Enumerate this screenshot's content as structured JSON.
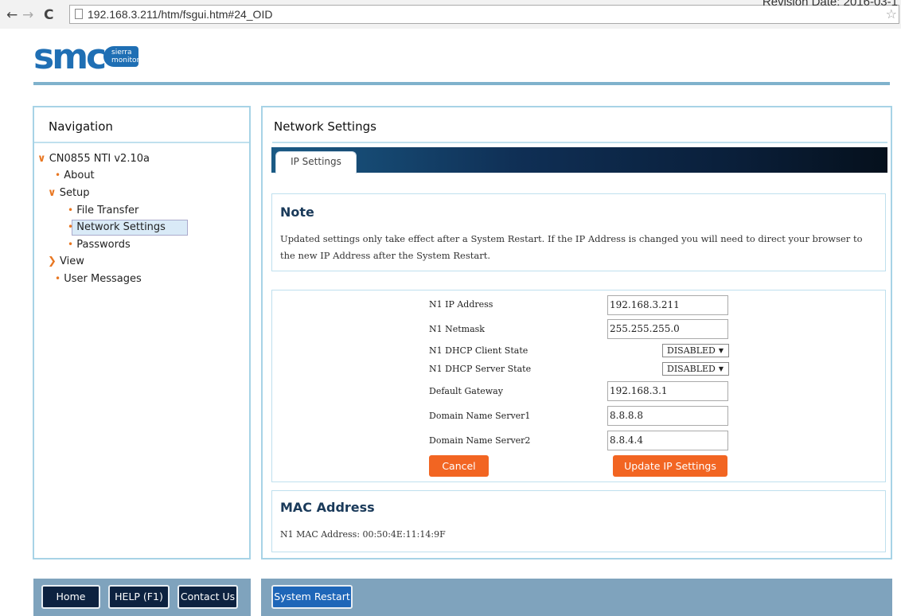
{
  "browser": {
    "back": "←",
    "forward": "→",
    "reload": "C",
    "url": "192.168.3.211/htm/fsgui.htm#24_OID",
    "revision": "Revision Date: 2016-03-1"
  },
  "logo": {
    "brand": "smc",
    "badge_line1": "sierra",
    "badge_line2": "monitor"
  },
  "nav": {
    "title": "Navigation",
    "items": [
      {
        "label": "CN0855 NTI v2.10a",
        "marker": "v"
      },
      {
        "label": "About",
        "marker": "•"
      },
      {
        "label": "Setup",
        "marker": "v"
      },
      {
        "label": "File Transfer",
        "marker": "•"
      },
      {
        "label": "Network Settings",
        "marker": "•"
      },
      {
        "label": "Passwords",
        "marker": "•"
      },
      {
        "label": "View",
        "marker": ">"
      },
      {
        "label": "User Messages",
        "marker": "•"
      }
    ]
  },
  "main": {
    "title": "Network Settings",
    "tab": "IP Settings",
    "note": {
      "title": "Note",
      "text": "Updated settings only take effect after a System Restart. If the IP Address is changed you will need to direct your browser to the new IP Address after the System Restart."
    },
    "fields": [
      {
        "label": "N1 IP Address",
        "value": "192.168.3.211"
      },
      {
        "label": "N1 Netmask",
        "value": "255.255.255.0"
      },
      {
        "label": "N1 DHCP Client State",
        "value": "DISABLED"
      },
      {
        "label": "N1 DHCP Server State",
        "value": "DISABLED"
      },
      {
        "label": "Default Gateway",
        "value": "192.168.3.1"
      },
      {
        "label": "Domain Name Server1",
        "value": "8.8.8.8"
      },
      {
        "label": "Domain Name Server2",
        "value": "8.8.4.4"
      }
    ],
    "cancel_label": "Cancel",
    "update_label": "Update IP Settings",
    "mac": {
      "title": "MAC Address",
      "text": "N1 MAC Address: 00:50:4E:11:14:9F"
    }
  },
  "footer": {
    "home": "Home",
    "help": "HELP (F1)",
    "contact": "Contact Us",
    "restart": "System Restart"
  },
  "colors": {
    "accent_orange": "#f26522",
    "brand_blue": "#1f6fb4",
    "footer_bar": "#7fa3bd"
  }
}
